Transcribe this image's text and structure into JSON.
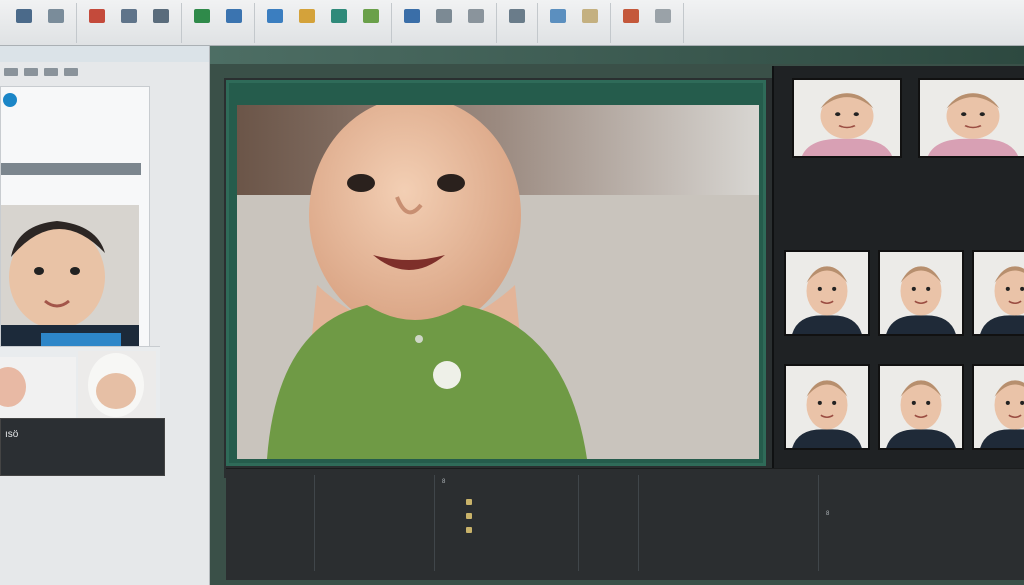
{
  "ribbon": {
    "groups": [
      {
        "buttons": [
          {
            "label": "",
            "color": "#4b6a8a"
          },
          {
            "label": "",
            "color": "#7a8c9a"
          }
        ]
      },
      {
        "buttons": [
          {
            "label": "",
            "color": "#c44a3b"
          },
          {
            "label": "",
            "color": "#5f748a"
          },
          {
            "label": "",
            "color": "#5a6c7c"
          }
        ]
      },
      {
        "buttons": [
          {
            "label": "",
            "color": "#2f8a4a"
          },
          {
            "label": "",
            "color": "#3b74b0"
          }
        ]
      },
      {
        "buttons": [
          {
            "label": "",
            "color": "#3b7ec0"
          },
          {
            "label": "",
            "color": "#d4a23a"
          },
          {
            "label": "",
            "color": "#2f8a7a"
          },
          {
            "label": "",
            "color": "#6aa04a"
          }
        ]
      },
      {
        "buttons": [
          {
            "label": "",
            "color": "#3a6ea8"
          },
          {
            "label": "",
            "color": "#7c8a94"
          },
          {
            "label": "",
            "color": "#8a949c"
          }
        ]
      },
      {
        "buttons": [
          {
            "label": "",
            "color": "#6a7c8a"
          }
        ]
      },
      {
        "buttons": [
          {
            "label": "",
            "color": "#5b8fbf"
          },
          {
            "label": "",
            "color": "#c4b080"
          }
        ]
      },
      {
        "buttons": [
          {
            "label": "",
            "color": "#c4583b"
          },
          {
            "label": "",
            "color": "#9aa2a8"
          }
        ]
      }
    ]
  },
  "left_panel": {
    "header": "",
    "card_brand": "",
    "card_tag": "",
    "dark_big": "ısö",
    "dark_rows": [
      "",
      ""
    ]
  },
  "workspace": {
    "title": "",
    "viewer_bar_left": "",
    "viewer_bar_right": ""
  },
  "gallery": {
    "captions": [
      "",
      ""
    ],
    "row_captions": [
      "",
      "",
      ""
    ]
  },
  "bottom": {
    "col1": [
      "",
      "",
      "",
      ""
    ],
    "col2": [
      "",
      "",
      "",
      ""
    ],
    "col3": [
      "8",
      "",
      "",
      ""
    ],
    "col4": [
      "",
      "",
      "",
      ""
    ],
    "col5": [
      "",
      "",
      "",
      ""
    ],
    "col6": [
      "",
      "",
      "8",
      ""
    ]
  },
  "colors": {
    "accent": "#2f6b59",
    "viewer_frame": "#255c4c",
    "baby_shirt": "#6f9a45",
    "workspace_dark": "#2a2f30"
  }
}
